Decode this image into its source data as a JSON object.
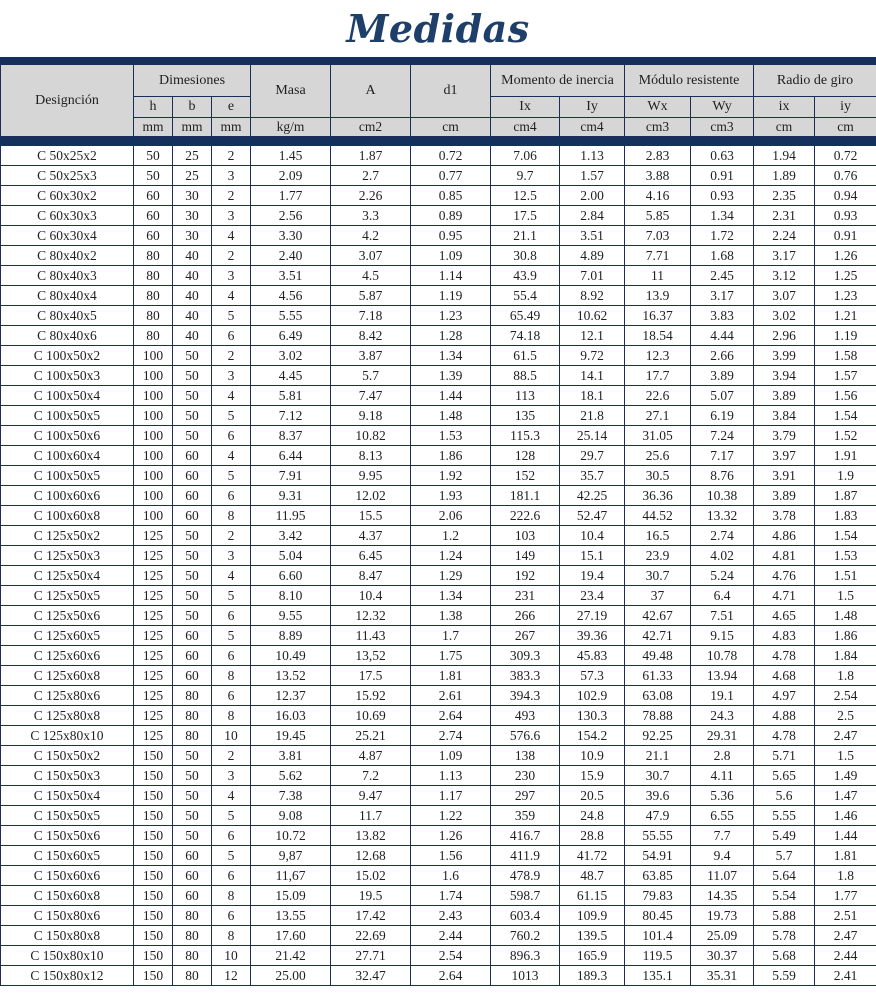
{
  "title": "Medidas",
  "headers": {
    "designation": "Designción",
    "dimensions": "Dimesiones",
    "h": "h",
    "b": "b",
    "e": "e",
    "mass": "Masa",
    "area": "A",
    "d1": "d1",
    "inertia": "Momento de inercia",
    "ix_moment": "Ix",
    "iy_moment": "Iy",
    "modulus": "Módulo resistente",
    "wx": "Wx",
    "wy": "Wy",
    "gyration": "Radio de giro",
    "ix_radius": "ix",
    "iy_radius": "iy"
  },
  "units": [
    "mm",
    "mm",
    "mm",
    "kg/m",
    "cm2",
    "cm",
    "cm4",
    "cm4",
    "cm3",
    "cm3",
    "cm",
    "cm"
  ],
  "rows": [
    [
      "C 50x25x2",
      "50",
      "25",
      "2",
      "1.45",
      "1.87",
      "0.72",
      "7.06",
      "1.13",
      "2.83",
      "0.63",
      "1.94",
      "0.72"
    ],
    [
      "C 50x25x3",
      "50",
      "25",
      "3",
      "2.09",
      "2.7",
      "0.77",
      "9.7",
      "1.57",
      "3.88",
      "0.91",
      "1.89",
      "0.76"
    ],
    [
      "C 60x30x2",
      "60",
      "30",
      "2",
      "1.77",
      "2.26",
      "0.85",
      "12.5",
      "2.00",
      "4.16",
      "0.93",
      "2.35",
      "0.94"
    ],
    [
      "C 60x30x3",
      "60",
      "30",
      "3",
      "2.56",
      "3.3",
      "0.89",
      "17.5",
      "2.84",
      "5.85",
      "1.34",
      "2.31",
      "0.93"
    ],
    [
      "C 60x30x4",
      "60",
      "30",
      "4",
      "3.30",
      "4.2",
      "0.95",
      "21.1",
      "3.51",
      "7.03",
      "1.72",
      "2.24",
      "0.91"
    ],
    [
      "C 80x40x2",
      "80",
      "40",
      "2",
      "2.40",
      "3.07",
      "1.09",
      "30.8",
      "4.89",
      "7.71",
      "1.68",
      "3.17",
      "1.26"
    ],
    [
      "C 80x40x3",
      "80",
      "40",
      "3",
      "3.51",
      "4.5",
      "1.14",
      "43.9",
      "7.01",
      "11",
      "2.45",
      "3.12",
      "1.25"
    ],
    [
      "C 80x40x4",
      "80",
      "40",
      "4",
      "4.56",
      "5.87",
      "1.19",
      "55.4",
      "8.92",
      "13.9",
      "3.17",
      "3.07",
      "1.23"
    ],
    [
      "C 80x40x5",
      "80",
      "40",
      "5",
      "5.55",
      "7.18",
      "1.23",
      "65.49",
      "10.62",
      "16.37",
      "3.83",
      "3.02",
      "1.21"
    ],
    [
      "C 80x40x6",
      "80",
      "40",
      "6",
      "6.49",
      "8.42",
      "1.28",
      "74.18",
      "12.1",
      "18.54",
      "4.44",
      "2.96",
      "1.19"
    ],
    [
      "C 100x50x2",
      "100",
      "50",
      "2",
      "3.02",
      "3.87",
      "1.34",
      "61.5",
      "9.72",
      "12.3",
      "2.66",
      "3.99",
      "1.58"
    ],
    [
      "C 100x50x3",
      "100",
      "50",
      "3",
      "4.45",
      "5.7",
      "1.39",
      "88.5",
      "14.1",
      "17.7",
      "3.89",
      "3.94",
      "1.57"
    ],
    [
      "C 100x50x4",
      "100",
      "50",
      "4",
      "5.81",
      "7.47",
      "1.44",
      "113",
      "18.1",
      "22.6",
      "5.07",
      "3.89",
      "1.56"
    ],
    [
      "C 100x50x5",
      "100",
      "50",
      "5",
      "7.12",
      "9.18",
      "1.48",
      "135",
      "21.8",
      "27.1",
      "6.19",
      "3.84",
      "1.54"
    ],
    [
      "C 100x50x6",
      "100",
      "50",
      "6",
      "8.37",
      "10.82",
      "1.53",
      "115.3",
      "25.14",
      "31.05",
      "7.24",
      "3.79",
      "1.52"
    ],
    [
      "C 100x60x4",
      "100",
      "60",
      "4",
      "6.44",
      "8.13",
      "1.86",
      "128",
      "29.7",
      "25.6",
      "7.17",
      "3.97",
      "1.91"
    ],
    [
      "C 100x50x5",
      "100",
      "60",
      "5",
      "7.91",
      "9.95",
      "1.92",
      "152",
      "35.7",
      "30.5",
      "8.76",
      "3.91",
      "1.9"
    ],
    [
      "C 100x60x6",
      "100",
      "60",
      "6",
      "9.31",
      "12.02",
      "1.93",
      "181.1",
      "42.25",
      "36.36",
      "10.38",
      "3.89",
      "1.87"
    ],
    [
      "C 100x60x8",
      "100",
      "60",
      "8",
      "11.95",
      "15.5",
      "2.06",
      "222.6",
      "52.47",
      "44.52",
      "13.32",
      "3.78",
      "1.83"
    ],
    [
      "C 125x50x2",
      "125",
      "50",
      "2",
      "3.42",
      "4.37",
      "1.2",
      "103",
      "10.4",
      "16.5",
      "2.74",
      "4.86",
      "1.54"
    ],
    [
      "C 125x50x3",
      "125",
      "50",
      "3",
      "5.04",
      "6.45",
      "1.24",
      "149",
      "15.1",
      "23.9",
      "4.02",
      "4.81",
      "1.53"
    ],
    [
      "C 125x50x4",
      "125",
      "50",
      "4",
      "6.60",
      "8.47",
      "1.29",
      "192",
      "19.4",
      "30.7",
      "5.24",
      "4.76",
      "1.51"
    ],
    [
      "C 125x50x5",
      "125",
      "50",
      "5",
      "8.10",
      "10.4",
      "1.34",
      "231",
      "23.4",
      "37",
      "6.4",
      "4.71",
      "1.5"
    ],
    [
      "C 125x50x6",
      "125",
      "50",
      "6",
      "9.55",
      "12.32",
      "1.38",
      "266",
      "27.19",
      "42.67",
      "7.51",
      "4.65",
      "1.48"
    ],
    [
      "C 125x60x5",
      "125",
      "60",
      "5",
      "8.89",
      "11.43",
      "1.7",
      "267",
      "39.36",
      "42.71",
      "9.15",
      "4.83",
      "1.86"
    ],
    [
      "C 125x60x6",
      "125",
      "60",
      "6",
      "10.49",
      "13,52",
      "1.75",
      "309.3",
      "45.83",
      "49.48",
      "10.78",
      "4.78",
      "1.84"
    ],
    [
      "C 125x60x8",
      "125",
      "60",
      "8",
      "13.52",
      "17.5",
      "1.81",
      "383.3",
      "57.3",
      "61.33",
      "13.94",
      "4.68",
      "1.8"
    ],
    [
      "C 125x80x6",
      "125",
      "80",
      "6",
      "12.37",
      "15.92",
      "2.61",
      "394.3",
      "102.9",
      "63.08",
      "19.1",
      "4.97",
      "2.54"
    ],
    [
      "C 125x80x8",
      "125",
      "80",
      "8",
      "16.03",
      "10.69",
      "2.64",
      "493",
      "130.3",
      "78.88",
      "24.3",
      "4.88",
      "2.5"
    ],
    [
      "C 125x80x10",
      "125",
      "80",
      "10",
      "19.45",
      "25.21",
      "2.74",
      "576.6",
      "154.2",
      "92.25",
      "29.31",
      "4.78",
      "2.47"
    ],
    [
      "C 150x50x2",
      "150",
      "50",
      "2",
      "3.81",
      "4.87",
      "1.09",
      "138",
      "10.9",
      "21.1",
      "2.8",
      "5.71",
      "1.5"
    ],
    [
      "C 150x50x3",
      "150",
      "50",
      "3",
      "5.62",
      "7.2",
      "1.13",
      "230",
      "15.9",
      "30.7",
      "4.11",
      "5.65",
      "1.49"
    ],
    [
      "C 150x50x4",
      "150",
      "50",
      "4",
      "7.38",
      "9.47",
      "1.17",
      "297",
      "20.5",
      "39.6",
      "5.36",
      "5.6",
      "1.47"
    ],
    [
      "C 150x50x5",
      "150",
      "50",
      "5",
      "9.08",
      "11.7",
      "1.22",
      "359",
      "24.8",
      "47.9",
      "6.55",
      "5.55",
      "1.46"
    ],
    [
      "C 150x50x6",
      "150",
      "50",
      "6",
      "10.72",
      "13.82",
      "1.26",
      "416.7",
      "28.8",
      "55.55",
      "7.7",
      "5.49",
      "1.44"
    ],
    [
      "C 150x60x5",
      "150",
      "60",
      "5",
      "9,87",
      "12.68",
      "1.56",
      "411.9",
      "41.72",
      "54.91",
      "9.4",
      "5.7",
      "1.81"
    ],
    [
      "C 150x60x6",
      "150",
      "60",
      "6",
      "11,67",
      "15.02",
      "1.6",
      "478.9",
      "48.7",
      "63.85",
      "11.07",
      "5.64",
      "1.8"
    ],
    [
      "C 150x60x8",
      "150",
      "60",
      "8",
      "15.09",
      "19.5",
      "1.74",
      "598.7",
      "61.15",
      "79.83",
      "14.35",
      "5.54",
      "1.77"
    ],
    [
      "C 150x80x6",
      "150",
      "80",
      "6",
      "13.55",
      "17.42",
      "2.43",
      "603.4",
      "109.9",
      "80.45",
      "19.73",
      "5.88",
      "2.51"
    ],
    [
      "C 150x80x8",
      "150",
      "80",
      "8",
      "17.60",
      "22.69",
      "2.44",
      "760.2",
      "139.5",
      "101.4",
      "25.09",
      "5.78",
      "2.47"
    ],
    [
      "C 150x80x10",
      "150",
      "80",
      "10",
      "21.42",
      "27.71",
      "2.54",
      "896.3",
      "165.9",
      "119.5",
      "30.37",
      "5.68",
      "2.44"
    ],
    [
      "C 150x80x12",
      "150",
      "80",
      "12",
      "25.00",
      "32.47",
      "2.64",
      "1013",
      "189.3",
      "135.1",
      "35.31",
      "5.59",
      "2.41"
    ]
  ]
}
